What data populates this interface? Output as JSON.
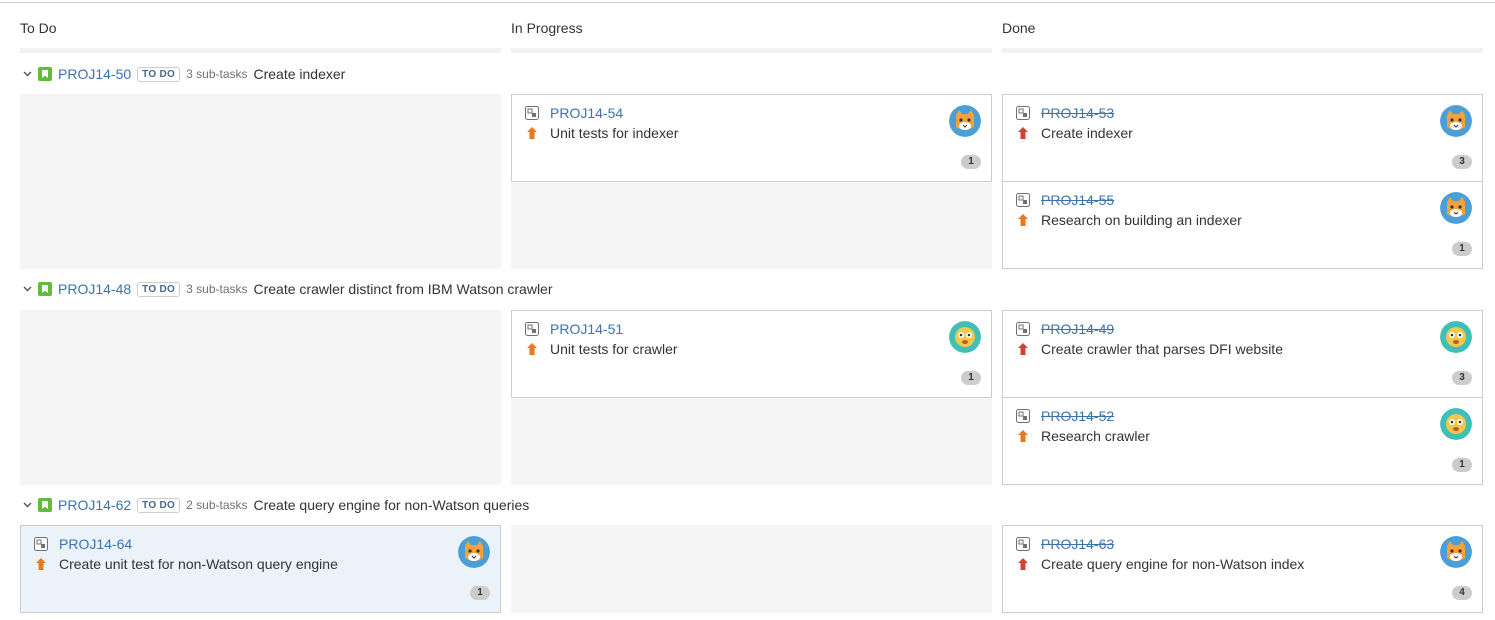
{
  "columns": [
    {
      "label": "To Do"
    },
    {
      "label": "In Progress"
    },
    {
      "label": "Done"
    }
  ],
  "colors": {
    "link": "#3b73af",
    "story": "#63ba3c",
    "priority_major": "#e8791e",
    "priority_critical": "#d04437",
    "avatar_cat_bg": "#4a9fd8",
    "avatar_face_bg": "#3fbfb8"
  },
  "swimlanes": [
    {
      "key": "PROJ14-50",
      "status": "TO DO",
      "subtasks": "3 sub-tasks",
      "title": "Create indexer",
      "in_progress": [
        {
          "key": "PROJ14-54",
          "summary": "Unit tests for indexer",
          "badge": "1",
          "priority": "major",
          "avatar": "cat"
        }
      ],
      "done": [
        {
          "key": "PROJ14-53",
          "summary": "Create indexer",
          "badge": "3",
          "priority": "critical",
          "avatar": "cat"
        },
        {
          "key": "PROJ14-55",
          "summary": "Research on building an indexer",
          "badge": "1",
          "priority": "major",
          "avatar": "cat"
        }
      ]
    },
    {
      "key": "PROJ14-48",
      "status": "TO DO",
      "subtasks": "3 sub-tasks",
      "title": "Create crawler distinct from IBM Watson crawler",
      "in_progress": [
        {
          "key": "PROJ14-51",
          "summary": "Unit tests for crawler",
          "badge": "1",
          "priority": "major",
          "avatar": "face"
        }
      ],
      "done": [
        {
          "key": "PROJ14-49",
          "summary": "Create crawler that parses DFI website",
          "badge": "3",
          "priority": "critical",
          "avatar": "face"
        },
        {
          "key": "PROJ14-52",
          "summary": "Research crawler",
          "badge": "1",
          "priority": "major",
          "avatar": "face"
        }
      ]
    },
    {
      "key": "PROJ14-62",
      "status": "TO DO",
      "subtasks": "2 sub-tasks",
      "title": "Create query engine for non-Watson queries",
      "todo": [
        {
          "key": "PROJ14-64",
          "summary": "Create unit test for non-Watson query engine",
          "badge": "1",
          "priority": "major",
          "avatar": "cat"
        }
      ],
      "done": [
        {
          "key": "PROJ14-63",
          "summary": "Create query engine for non-Watson index",
          "badge": "4",
          "priority": "critical",
          "avatar": "cat"
        }
      ]
    }
  ]
}
